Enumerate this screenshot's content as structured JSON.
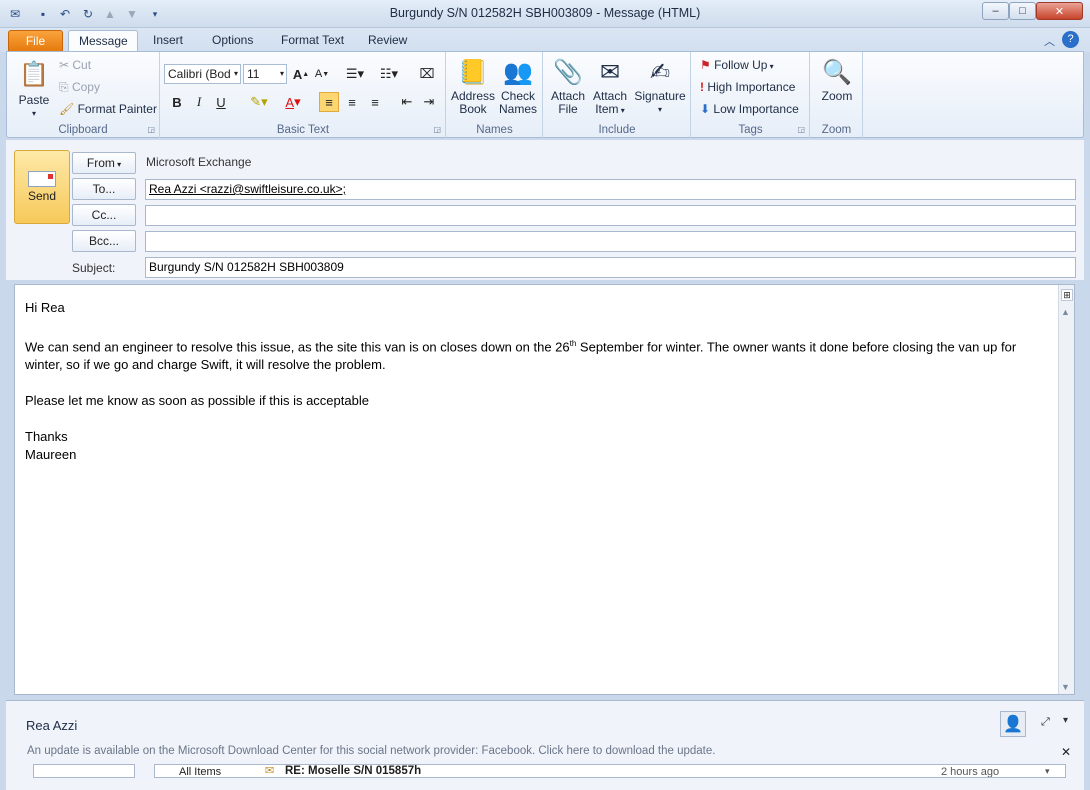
{
  "window": {
    "title": "Burgundy  S/N  012582H   SBH003809  -  Message (HTML)"
  },
  "tabs": [
    {
      "label": "File"
    },
    {
      "label": "Message"
    },
    {
      "label": "Insert"
    },
    {
      "label": "Options"
    },
    {
      "label": "Format Text"
    },
    {
      "label": "Review"
    }
  ],
  "ribbon": {
    "clipboard": {
      "paste": "Paste",
      "cut": "Cut",
      "copy": "Copy",
      "format_painter": "Format Painter",
      "label": "Clipboard"
    },
    "basic_text": {
      "font": "Calibri (Bod",
      "size": "11",
      "label": "Basic Text"
    },
    "names": {
      "address_book_1": "Address",
      "address_book_2": "Book",
      "check_names_1": "Check",
      "check_names_2": "Names",
      "label": "Names"
    },
    "include": {
      "attach_file_1": "Attach",
      "attach_file_2": "File",
      "attach_item_1": "Attach",
      "attach_item_2": "Item",
      "signature": "Signature",
      "label": "Include"
    },
    "tags": {
      "follow_up": "Follow Up",
      "high_importance": "High Importance",
      "low_importance": "Low Importance",
      "label": "Tags"
    },
    "zoom": {
      "zoom": "Zoom",
      "label": "Zoom"
    }
  },
  "compose": {
    "send": "Send",
    "from_btn": "From",
    "from_value": "Microsoft Exchange",
    "to_btn": "To...",
    "to_value": "Rea Azzi <razzi@swiftleisure.co.uk>;",
    "cc_btn": "Cc...",
    "cc_value": "",
    "bcc_btn": "Bcc...",
    "bcc_value": "",
    "subject_label": "Subject:",
    "subject_value": "Burgundy  S/N  012582H   SBH003809"
  },
  "message": {
    "greeting": "Hi Rea",
    "para1_a": "We can send an engineer to resolve this issue, as the site this van is on closes down on the 26",
    "para1_sup": "th",
    "para1_b": " September for winter.  The owner wants it done before closing the van up for winter, so if we go and charge Swift, it will resolve the problem.",
    "para2": "Please let me know as soon as possible if this is acceptable",
    "closing": "Thanks",
    "signature": "Maureen"
  },
  "people_pane": {
    "contact": "Rea Azzi",
    "update_notice": "An update is available on the Microsoft Download Center for this social network provider: Facebook. Click here to download the update.",
    "filter": "All Items",
    "item_subject": "RE: Moselle S/N 015857h",
    "item_time": "2 hours ago"
  }
}
